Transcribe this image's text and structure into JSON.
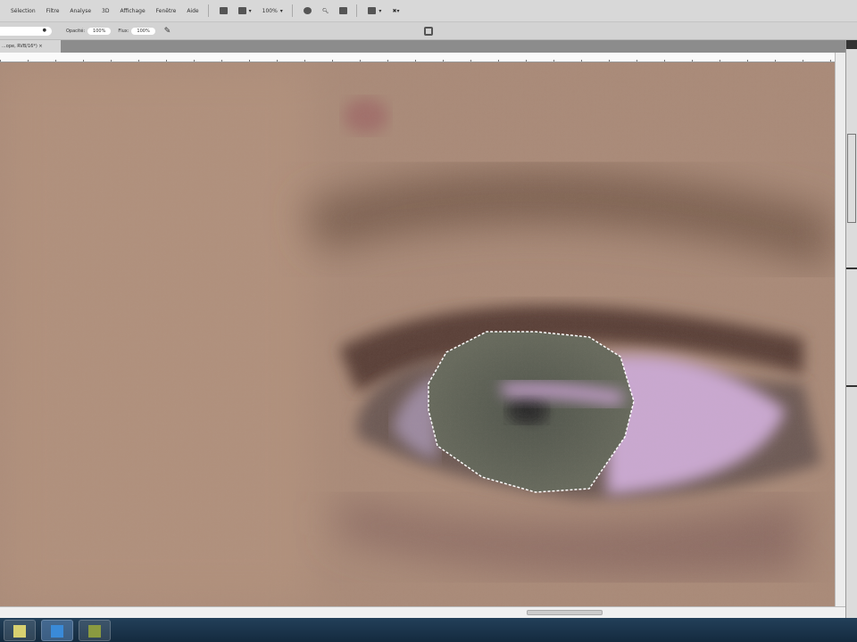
{
  "menubar": {
    "items": [
      "Sélection",
      "Filtre",
      "Analyse",
      "3D",
      "Affichage",
      "Fenêtre",
      "Aide"
    ],
    "zoom": "100%"
  },
  "options": {
    "opacity_label": "Opacité:",
    "opacity_value": "100%",
    "flow_label": "Flux:",
    "flow_value": "100%"
  },
  "document_tab": {
    "title": "...ope, RVB/16*)",
    "close": "×"
  },
  "taskbar": {
    "apps": [
      "explorer",
      "photoshop",
      "media"
    ]
  },
  "colors": {
    "skin": "#a98a78",
    "iris": "#5e6358",
    "sclera": "#c9a8d0",
    "taskbar": "#1a334a"
  }
}
